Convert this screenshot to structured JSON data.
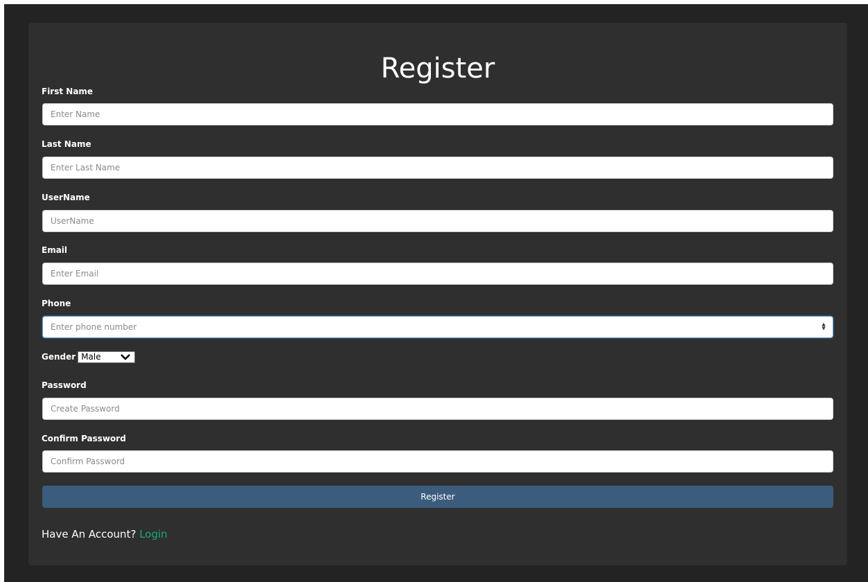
{
  "form": {
    "title": "Register",
    "first_name": {
      "label": "First Name",
      "placeholder": "Enter Name",
      "value": ""
    },
    "last_name": {
      "label": "Last Name",
      "placeholder": "Enter Last Name",
      "value": ""
    },
    "username": {
      "label": "UserName",
      "placeholder": "UserName",
      "value": ""
    },
    "email": {
      "label": "Email",
      "placeholder": "Enter Email",
      "value": ""
    },
    "phone": {
      "label": "Phone",
      "placeholder": "Enter phone number",
      "value": ""
    },
    "gender": {
      "label": "Gender",
      "selected": "Male"
    },
    "password": {
      "label": "Password",
      "placeholder": "Create Password",
      "value": ""
    },
    "confirm_password": {
      "label": "Confirm Password",
      "placeholder": "Confirm Password",
      "value": ""
    },
    "submit_label": "Register",
    "account_prompt": "Have An Account?",
    "login_label": "Login"
  },
  "colors": {
    "page_background": "#232323",
    "card_background": "#2f2f2f",
    "button": "#3b5c7d",
    "link": "#19a974"
  },
  "icons": {
    "gender_dropdown": "chevron-down-icon",
    "phone_spinner": "spinner-icon"
  }
}
